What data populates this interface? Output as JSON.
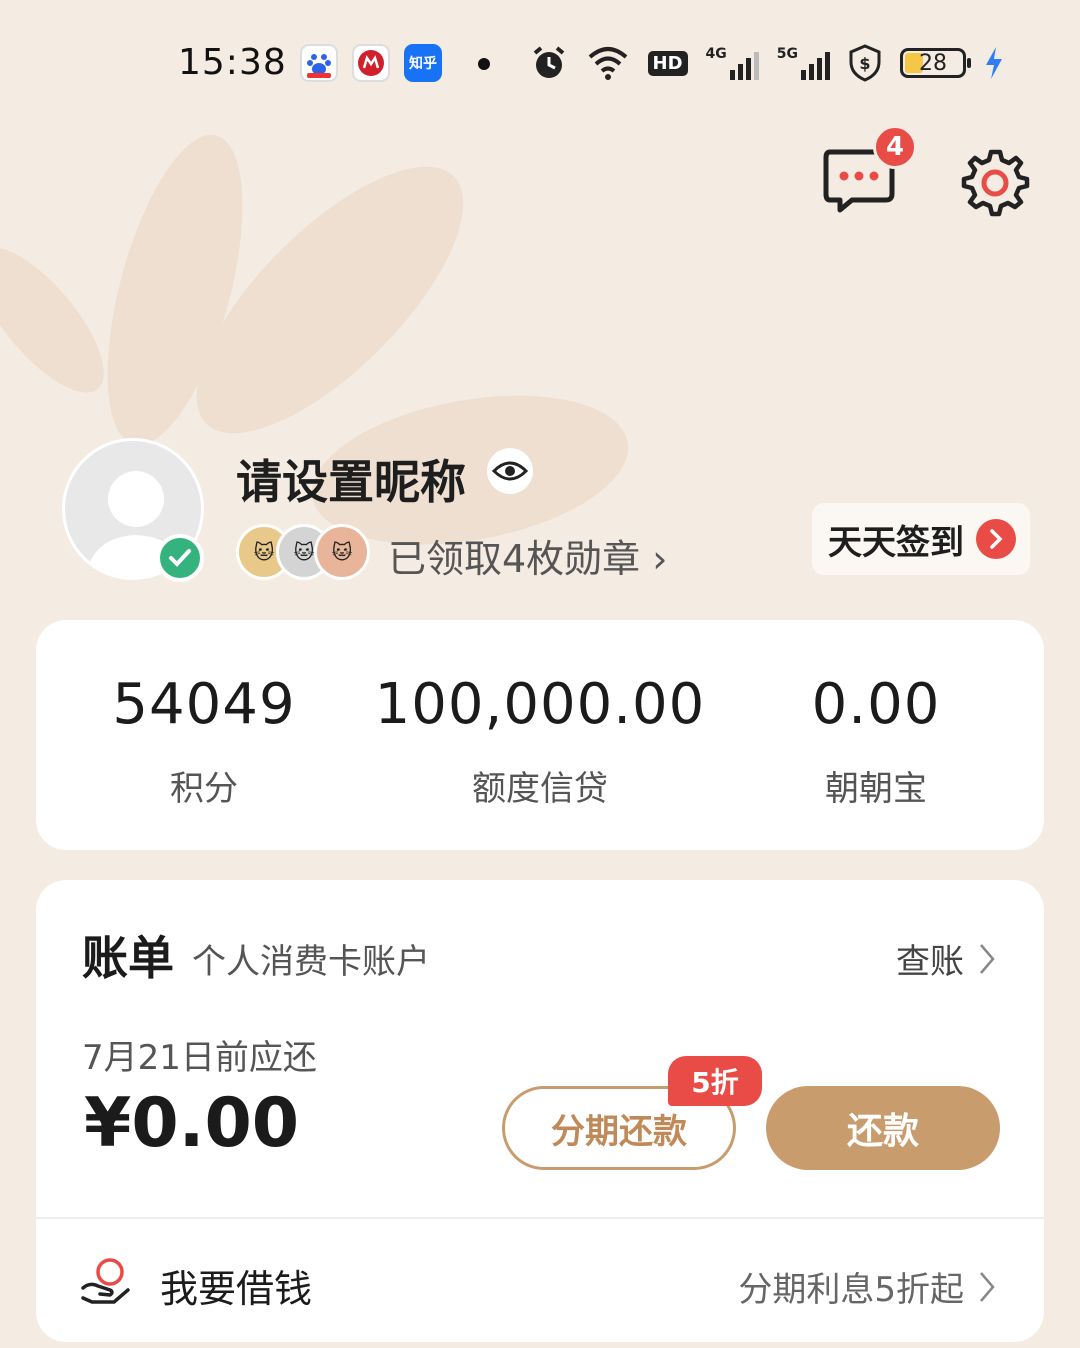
{
  "status_bar": {
    "time": "15:38",
    "apps": [
      {
        "icon": "baidu-icon",
        "label": "du",
        "color": "#2d63e8"
      },
      {
        "icon": "cmb-bank-icon",
        "label": "M",
        "color": "#d0202c"
      },
      {
        "icon": "zhihu-icon",
        "label": "知乎",
        "color": "#1772f6"
      }
    ],
    "network_4g": "4G",
    "network_5g": "5G",
    "hd_label": "HD",
    "battery": "28"
  },
  "header": {
    "message_badge": "4"
  },
  "profile": {
    "nickname": "请设置昵称",
    "medals_text": "已领取4枚勋章",
    "checkin_label": "天天签到"
  },
  "stats": [
    {
      "value": "54049",
      "label": "积分"
    },
    {
      "value": "100,000.00",
      "label": "额度信贷"
    },
    {
      "value": "0.00",
      "label": "朝朝宝"
    }
  ],
  "bill": {
    "title": "账单",
    "subtitle": "个人消费卡账户",
    "check_label": "查账",
    "due_label": "7月21日前应还",
    "due_amount": "¥0.00",
    "installment_label": "分期还款",
    "discount_tag": "5折",
    "repay_label": "还款"
  },
  "borrow": {
    "label": "我要借钱",
    "promo": "分期利息5折起"
  },
  "colors": {
    "background": "#f4ebe2",
    "accent_gold": "#c99c6e",
    "badge_red": "#e94c47",
    "verified_green": "#35b37e"
  }
}
